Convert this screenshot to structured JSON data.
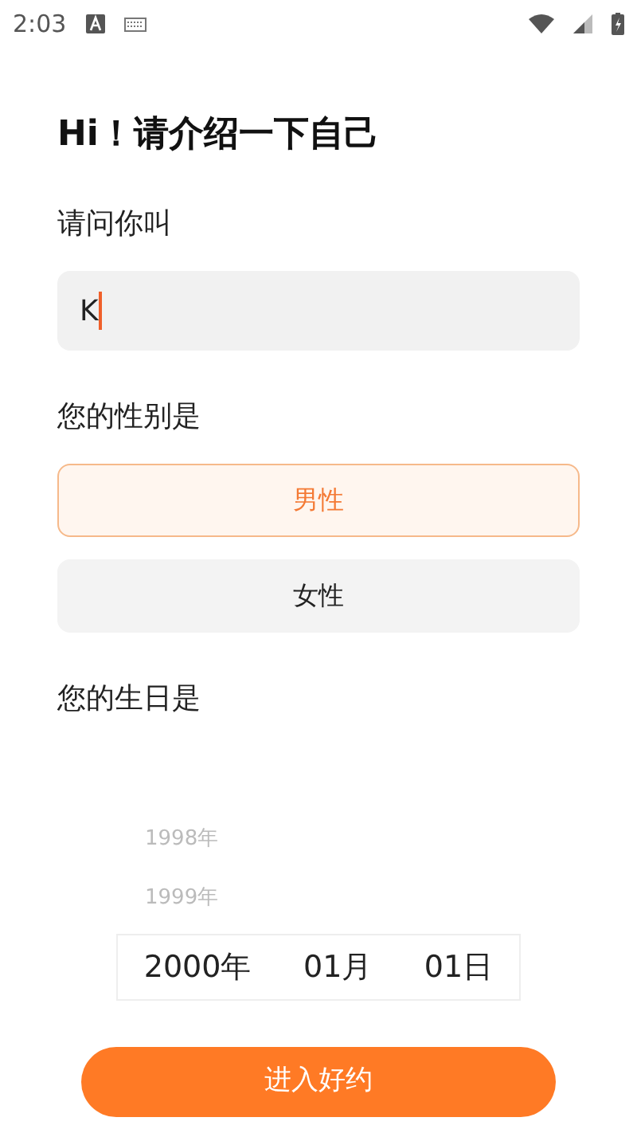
{
  "status_bar": {
    "time": "2:03"
  },
  "title": "Hi！请介绍一下自己",
  "name_section": {
    "label": "请问你叫",
    "value": "K"
  },
  "gender_section": {
    "label": "您的性别是",
    "options": [
      {
        "label": "男性",
        "selected": true
      },
      {
        "label": "女性",
        "selected": false
      }
    ]
  },
  "birthday_section": {
    "label": "您的生日是",
    "years_above": [
      "1998年",
      "1999年"
    ],
    "selected": {
      "year": "2000年",
      "month": "01月",
      "day": "01日"
    }
  },
  "submit_button": "进入好约"
}
